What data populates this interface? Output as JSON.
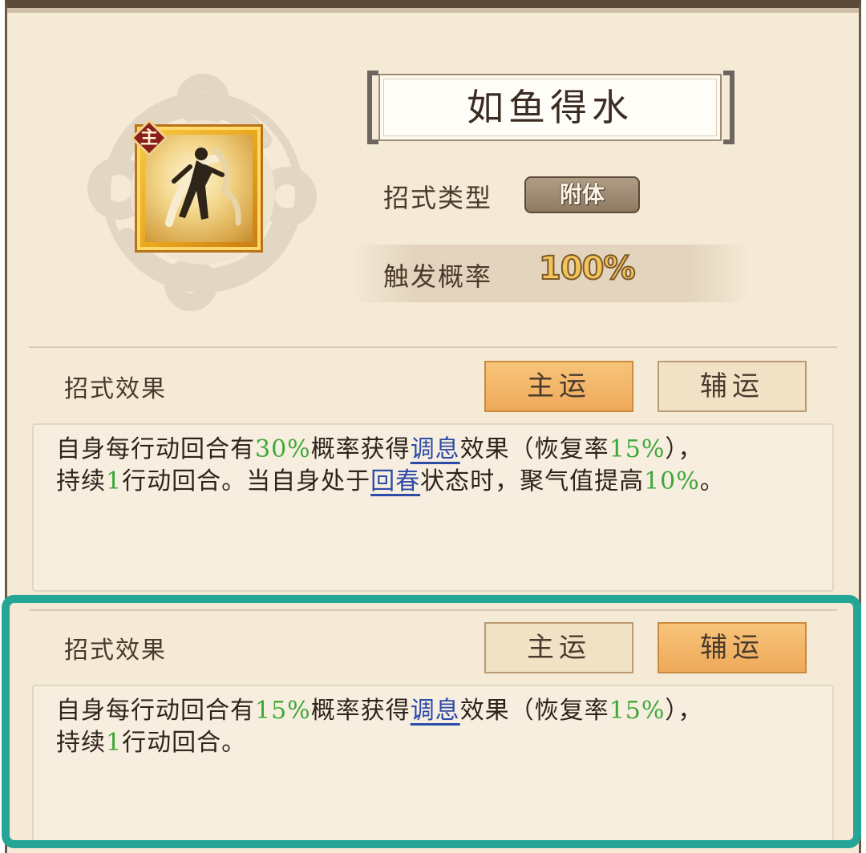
{
  "skill": {
    "name": "如鱼得水",
    "role_badge": "主",
    "type_label": "招式类型",
    "type_value": "附体",
    "prob_label": "触发概率",
    "prob_value": "100%"
  },
  "section_top": {
    "label": "招式效果",
    "tab_main": "主运",
    "tab_aux": "辅运",
    "active_tab": "main",
    "line1": {
      "a": "自身每行动回合有",
      "v1": "30%",
      "b": "概率获得",
      "k1": "调息",
      "c": "效果（恢复率",
      "v2": "15%",
      "d": "），"
    },
    "line2": {
      "a": "持续",
      "v1": "1",
      "b": "行动回合。当自身处于",
      "k1": "回春",
      "c": "状态时，聚气值提高",
      "v2": "10%",
      "d": "。"
    }
  },
  "section_bottom": {
    "label": "招式效果",
    "tab_main": "主运",
    "tab_aux": "辅运",
    "active_tab": "aux",
    "line1": {
      "a": "自身每行动回合有",
      "v1": "15%",
      "b": "概率获得",
      "k1": "调息",
      "c": "效果（恢复率",
      "v2": "15%",
      "d": "），"
    },
    "line2": {
      "a": "持续",
      "v1": "1",
      "b": "行动回合。"
    }
  },
  "colors": {
    "panel_bg": "#f5ead6",
    "value_green": "#3fa83a",
    "keyword_blue": "#2c4ca8",
    "tab_active": "#efa95a",
    "highlight_border": "#24a596"
  }
}
